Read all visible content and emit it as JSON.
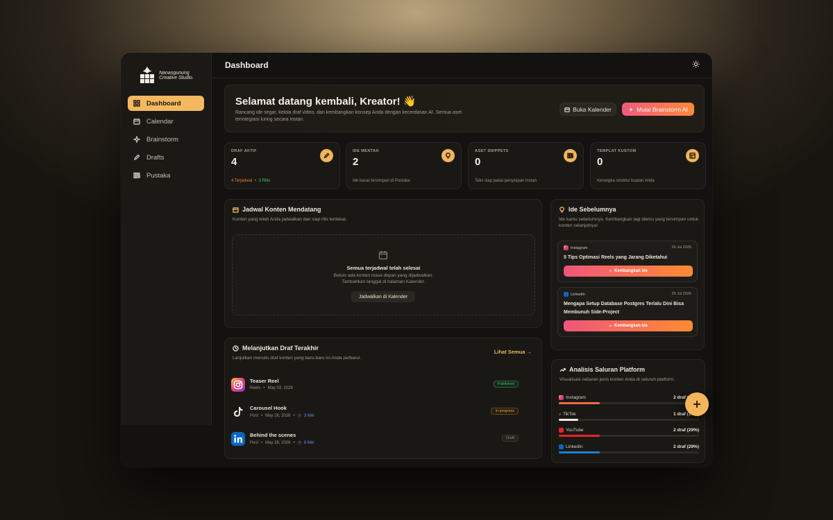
{
  "brand": {
    "name_line1": "Nanasgunung",
    "name_line2": "Creative Studio."
  },
  "nav": [
    {
      "label": "Dashboard",
      "icon": "grid-icon",
      "active": true
    },
    {
      "label": "Calendar",
      "icon": "calendar-icon"
    },
    {
      "label": "Brainstorm",
      "icon": "sparkle-icon"
    },
    {
      "label": "Drafts",
      "icon": "pencil-icon"
    },
    {
      "label": "Pustaka",
      "icon": "library-icon"
    }
  ],
  "topbar": {
    "title": "Dashboard",
    "theme_icon": "sun-icon"
  },
  "welcome": {
    "title": "Selamat datang kembali, Kreator!",
    "emoji": "👋",
    "subtitle": "Rancang ide segar, kelola draf video, dan kembangkan konsep Anda dengan kecerdasan AI. Semua aset terintegrasi luring secara instan.",
    "calendar_btn": "Buka Kalender",
    "brainstorm_btn": "Mulai Brainstorm AI"
  },
  "stats": [
    {
      "label": "DRAF AKTIF",
      "value": "4",
      "sub_a": "4 Terjadwal",
      "sub_sep": "•",
      "sub_b": "3 Rilis",
      "icon": "pencil-icon"
    },
    {
      "label": "IDE MENTAH",
      "value": "2",
      "sub": "Ide kasar tersimpan di Pustaka",
      "icon": "bulb-icon"
    },
    {
      "label": "ASET SNIPPETS",
      "value": "0",
      "sub": "Teks siap pakai penyisipan instan",
      "icon": "library-icon"
    },
    {
      "label": "TEMPLAT KUSTOM",
      "value": "0",
      "sub": "Kerangka struktur buatan Anda",
      "icon": "template-icon"
    }
  ],
  "schedule": {
    "title": "Jadwal Konten Mendatang",
    "subtitle": "Konten yang telah Anda jadwalkan dan siap rilis terdekat.",
    "empty_title": "Semua terjadwal telah selesai",
    "empty_line1": "Belum ada konten masa depan yang dijadwalkan.",
    "empty_line2": "Tambahkan tanggal di halaman Kalender.",
    "button": "Jadwalkan di Kalender"
  },
  "drafts": {
    "title": "Melanjutkan Draf Terakhir",
    "subtitle": "Lanjutkan menulis draf konten yang baru-baru ini Anda perbarui.",
    "see_all": "Lihat Semua →",
    "rows": [
      {
        "name": "Teaser Reel",
        "type": "Reels",
        "date": "May 03, 2026",
        "due": "",
        "status": "Published",
        "platform": "instagram"
      },
      {
        "name": "Carousel Hook",
        "type": "Post",
        "date": "May 28, 2026",
        "due": "3 Mei",
        "status": "In progress",
        "platform": "tiktok"
      },
      {
        "name": "Behind the scenes",
        "type": "Post",
        "date": "May 28, 2026",
        "due": "8 Mei",
        "status": "Draft",
        "platform": "linkedin"
      }
    ]
  },
  "ideas": {
    "title": "Ide Sebelumnya",
    "subtitle": "Ide kamu sebelumnya. Kembangkan lagi idemu yang tersimpan untuk konten selanjutnya!",
    "items": [
      {
        "platform": "Instagram",
        "date": "26 Jul 2026",
        "title": "5 Tips Optimasi Reels yang Jarang Diketahui",
        "button": "Kembangkan Ide"
      },
      {
        "platform": "LinkedIn",
        "date": "26 Jul 2026",
        "title": "Mengapa Setup Database Postgres Terlalu Dini Bisa Membunuh Side-Project",
        "button": "Kembangkan Ide"
      }
    ]
  },
  "analysis": {
    "title": "Analisis Saluran Platform",
    "subtitle": "Visualisasi sebaran jenis konten Anda di seluruh platform.",
    "rows": [
      {
        "name": "Instagram",
        "count": "2 draf (29%)",
        "fraction": 0.29,
        "color": "#f06a4a"
      },
      {
        "name": "TikTok",
        "count": "1 draf (14%)",
        "fraction": 0.14,
        "color": "#f1ede6"
      },
      {
        "name": "YouTube",
        "count": "2 draf (29%)",
        "fraction": 0.29,
        "color": "#e5242a"
      },
      {
        "name": "LinkedIn",
        "count": "2 draf (29%)",
        "fraction": 0.29,
        "color": "#1d7fd6"
      }
    ]
  },
  "fab": {
    "icon": "plus-icon"
  },
  "colors": {
    "accent": "#f4b860",
    "gradient_start": "#f05a7a",
    "gradient_end": "#ff8a3a"
  }
}
